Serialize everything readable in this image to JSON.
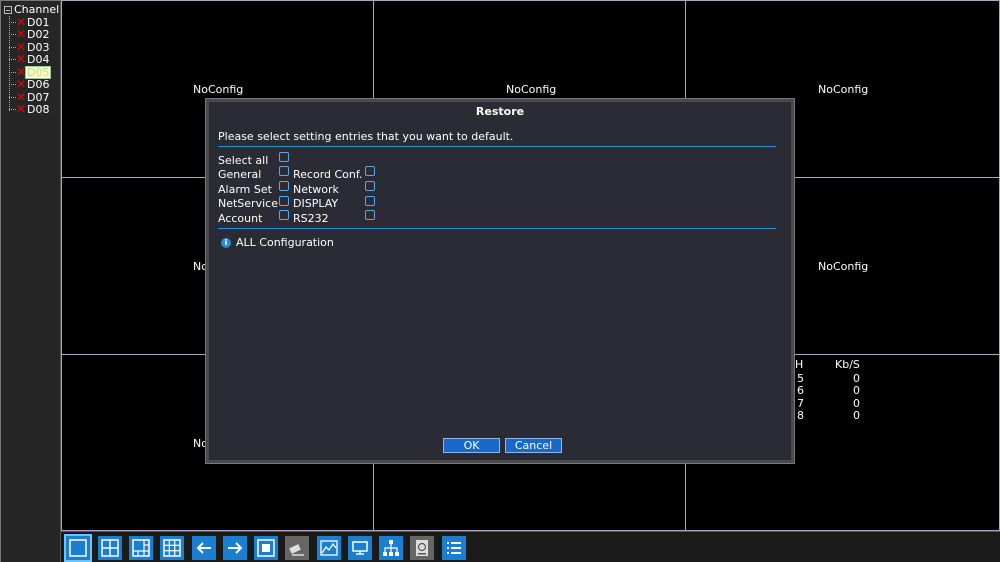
{
  "channel_tree": {
    "root_label": "Channel",
    "items": [
      {
        "label": "D01",
        "selected": false
      },
      {
        "label": "D02",
        "selected": false
      },
      {
        "label": "D03",
        "selected": false
      },
      {
        "label": "D04",
        "selected": false
      },
      {
        "label": "D05",
        "selected": true
      },
      {
        "label": "D06",
        "selected": false
      },
      {
        "label": "D07",
        "selected": false
      },
      {
        "label": "D08",
        "selected": false
      }
    ]
  },
  "grid": {
    "cell_labels": [
      "NoConfig",
      "NoConfig",
      "NoConfig",
      "No",
      "NoConfig",
      "No"
    ]
  },
  "stats": {
    "header_ch": "H",
    "header_rate": "Kb/S",
    "rows": [
      {
        "ch": "5",
        "rate": "0"
      },
      {
        "ch": "6",
        "rate": "0"
      },
      {
        "ch": "7",
        "rate": "0"
      },
      {
        "ch": "8",
        "rate": "0"
      }
    ]
  },
  "dialog": {
    "title": "Restore",
    "message": "Please select setting entries that you want to default.",
    "select_all": "Select all",
    "options_left": [
      "General",
      "Alarm Set",
      "NetService",
      "Account"
    ],
    "options_right": [
      "Record Conf.",
      "Network",
      "DISPLAY",
      "RS232"
    ],
    "all_config_label": "ALL Configuration",
    "ok_label": "OK",
    "cancel_label": "Cancel"
  },
  "toolbar": {
    "buttons": [
      {
        "icon": "single-view-icon"
      },
      {
        "icon": "quad-view-icon"
      },
      {
        "icon": "six-view-icon"
      },
      {
        "icon": "nine-view-icon"
      },
      {
        "icon": "previous-arrow-icon"
      },
      {
        "icon": "next-arrow-icon"
      },
      {
        "icon": "fullscreen-icon"
      },
      {
        "icon": "ptz-icon"
      },
      {
        "icon": "color-adjust-icon"
      },
      {
        "icon": "monitor-icon"
      },
      {
        "icon": "network-icon"
      },
      {
        "icon": "hdd-icon"
      },
      {
        "icon": "main-menu-icon"
      }
    ]
  },
  "colors": {
    "accent_blue": "#1a7fd1",
    "grid_border": "#b3a2c8",
    "dialog_bg": "#2a2b34",
    "separator": "#2f8ed1"
  }
}
